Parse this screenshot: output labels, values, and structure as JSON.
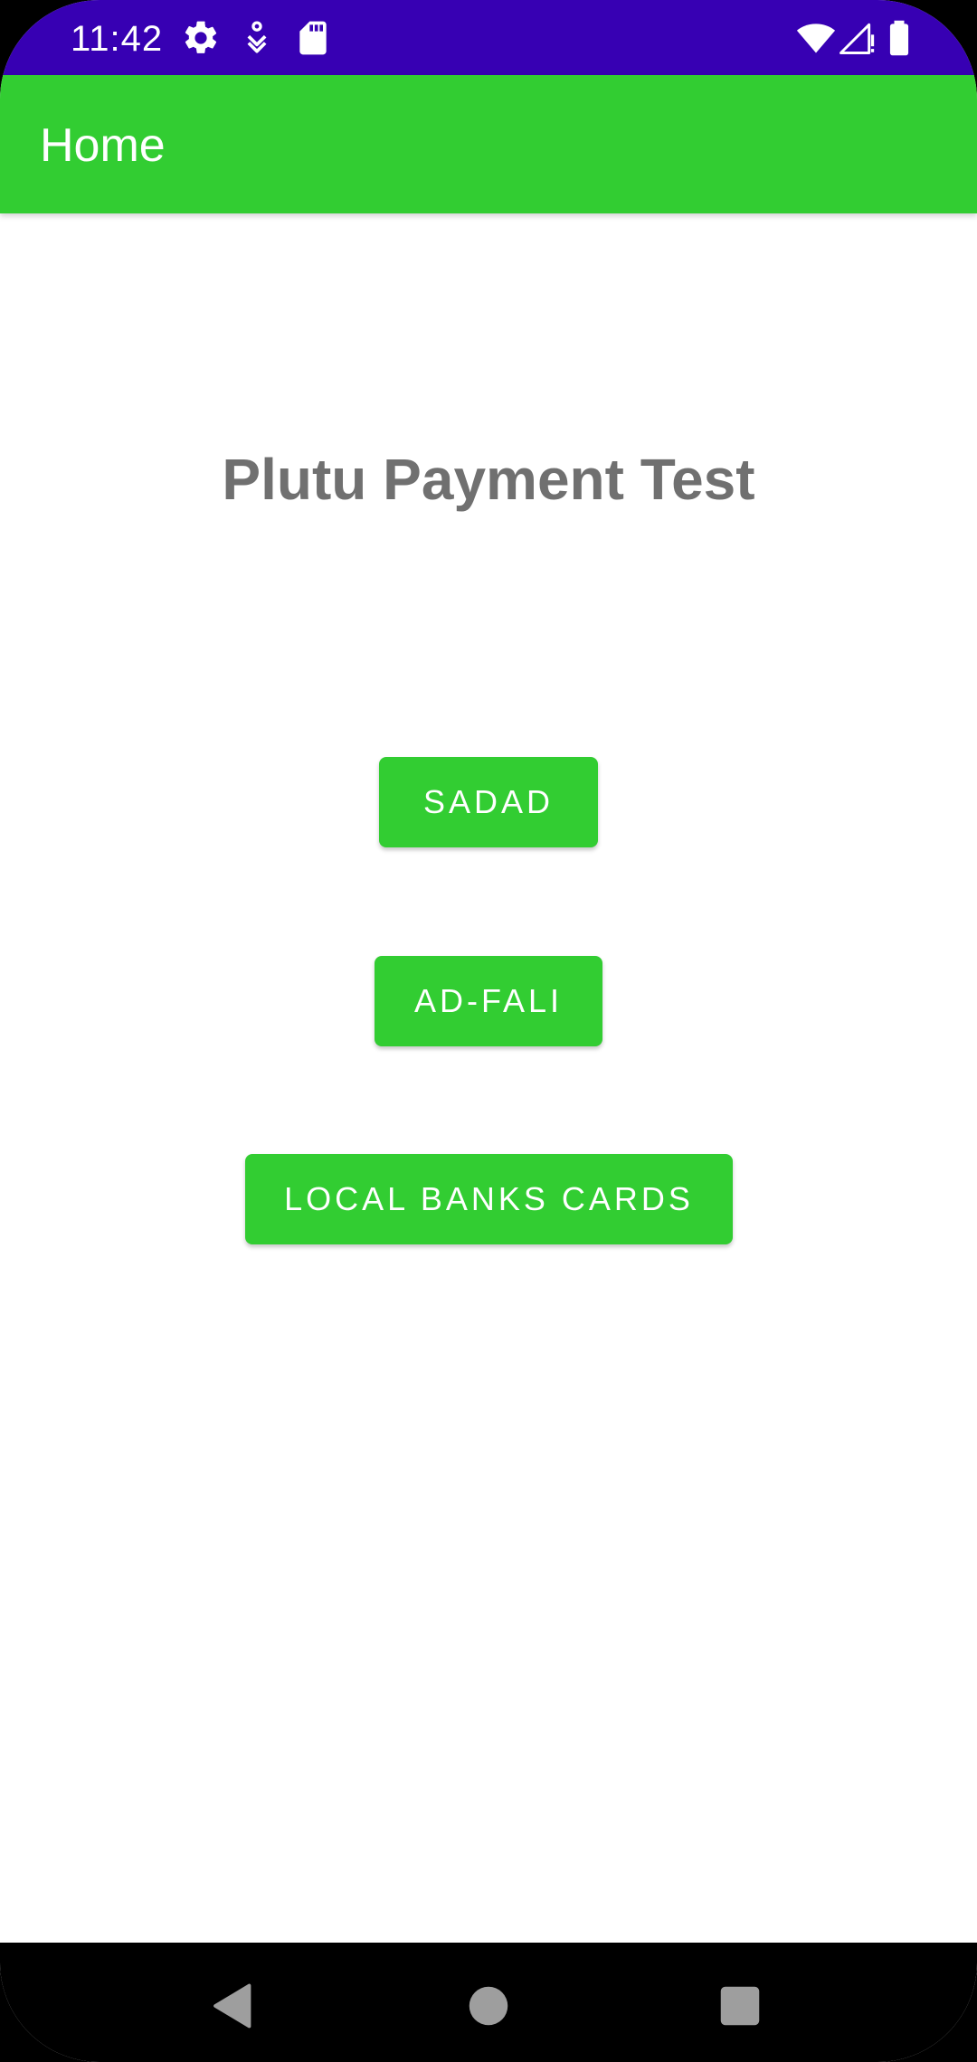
{
  "status_bar": {
    "time": "11:42",
    "left_icons": [
      "gear-icon",
      "sync-icon",
      "sd-card-icon"
    ],
    "right_icons": [
      "wifi-icon",
      "signal-icon",
      "battery-icon"
    ],
    "background_color": "#3700b3"
  },
  "app_bar": {
    "title": "Home",
    "background_color": "#32cd32"
  },
  "main": {
    "heading": "Plutu Payment Test",
    "buttons": [
      {
        "label": "SADAD"
      },
      {
        "label": "AD-FALI"
      },
      {
        "label": "LOCAL BANKS CARDS"
      }
    ],
    "button_color": "#32cd32"
  },
  "nav_bar": {
    "buttons": [
      "back-icon",
      "home-icon",
      "recents-icon"
    ]
  }
}
